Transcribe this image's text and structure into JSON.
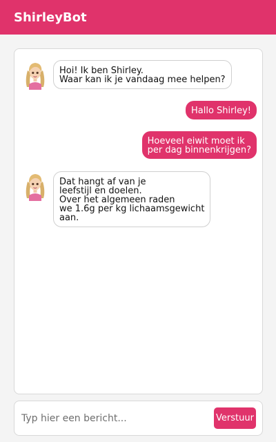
{
  "header": {
    "title": "ShirleyBot"
  },
  "colors": {
    "brand": "#e0336b",
    "panel_border": "#d8d8d8",
    "bot_bubble_border": "#cfcfcf"
  },
  "avatar": {
    "icon": "bot-avatar-icon",
    "alt": "Shirley"
  },
  "messages": [
    {
      "sender": "bot",
      "text": "Hoi! Ik ben Shirley.\nWaar kan ik je vandaag mee helpen?"
    },
    {
      "sender": "user",
      "text": "Hallo Shirley!"
    },
    {
      "sender": "user",
      "text": "Hoeveel eiwit moet ik\nper dag binnenkrijgen?"
    },
    {
      "sender": "bot",
      "text": "Dat hangt af van je\nleefstijl en doelen.\nOver het algemeen raden\nwe 1.6g per kg lichaamsgewicht\naan."
    }
  ],
  "composer": {
    "placeholder": "Typ hier een bericht...",
    "value": "",
    "send_label": "Verstuur"
  }
}
